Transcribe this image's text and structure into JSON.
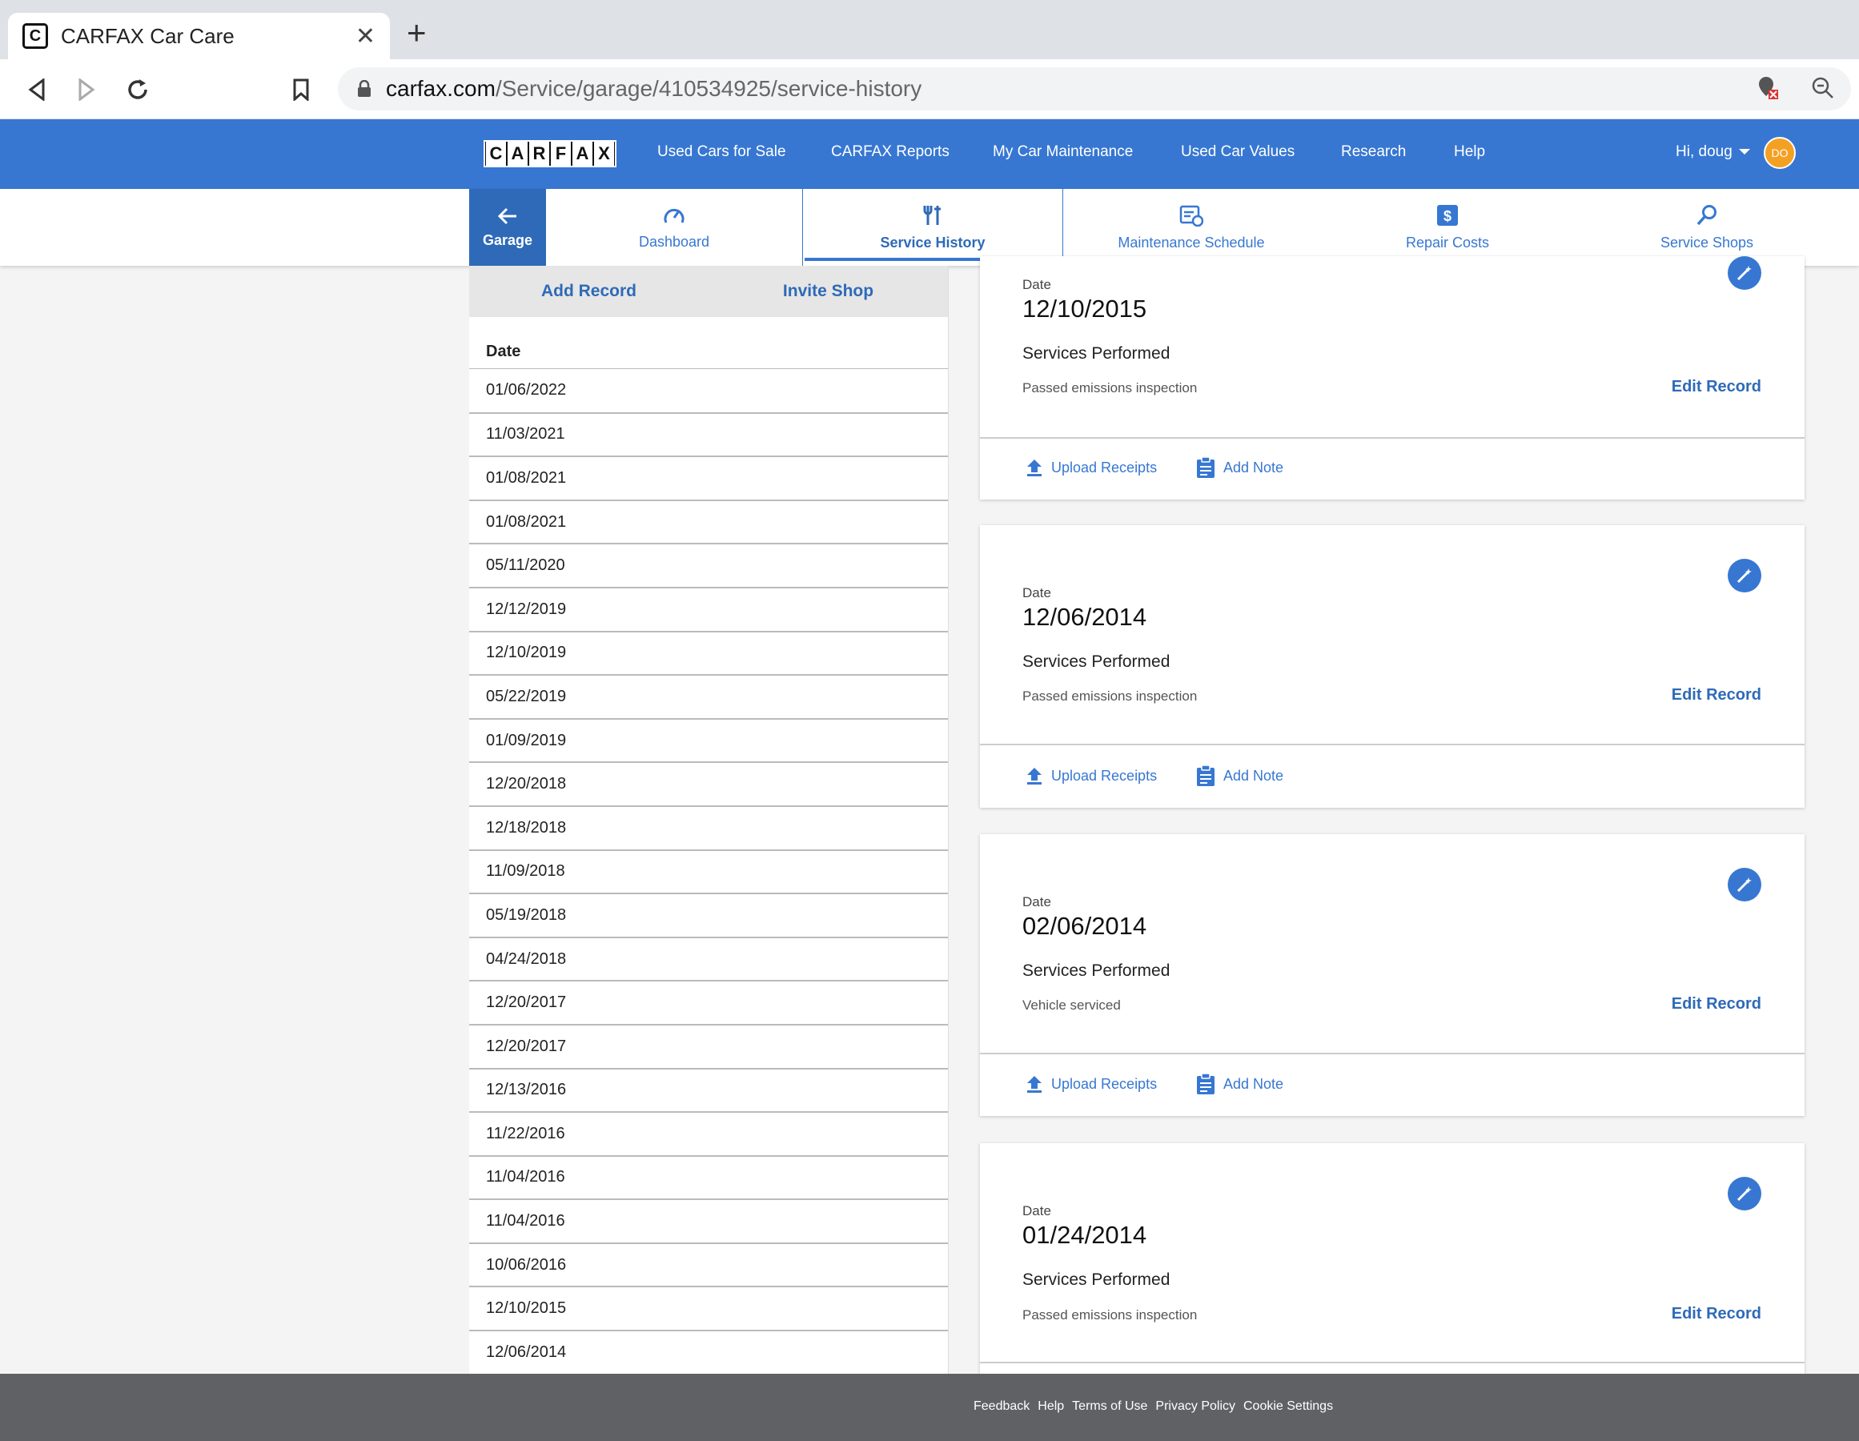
{
  "browser": {
    "tab_title": "CARFAX Car Care",
    "url_host": "carfax.com",
    "url_path": "/Service/garage/410534925/service-history"
  },
  "header": {
    "logo": "CARFAX",
    "nav": [
      "Used Cars for Sale",
      "CARFAX Reports",
      "My Car Maintenance",
      "Used Car Values",
      "Research",
      "Help"
    ],
    "user": "Hi, doug",
    "avatar": "DO"
  },
  "subnav": {
    "garage": "Garage",
    "tabs": [
      "Dashboard",
      "Service History",
      "Maintenance Schedule",
      "Repair Costs",
      "Service Shops"
    ],
    "active": "Service History"
  },
  "left_panel": {
    "add_record": "Add Record",
    "invite_shop": "Invite Shop",
    "date_header": "Date",
    "dates": [
      "01/06/2022",
      "11/03/2021",
      "01/08/2021",
      "01/08/2021",
      "05/11/2020",
      "12/12/2019",
      "12/10/2019",
      "05/22/2019",
      "01/09/2019",
      "12/20/2018",
      "12/18/2018",
      "11/09/2018",
      "05/19/2018",
      "04/24/2018",
      "12/20/2017",
      "12/20/2017",
      "12/13/2016",
      "11/22/2016",
      "11/04/2016",
      "11/04/2016",
      "10/06/2016",
      "12/10/2015",
      "12/06/2014"
    ]
  },
  "cards": [
    {
      "date_label": "Date",
      "date": "12/10/2015",
      "services_title": "Services Performed",
      "service": "Passed emissions inspection",
      "edit": "Edit Record",
      "upload": "Upload Receipts",
      "note": "Add Note"
    },
    {
      "date_label": "Date",
      "date": "12/06/2014",
      "services_title": "Services Performed",
      "service": "Passed emissions inspection",
      "edit": "Edit Record",
      "upload": "Upload Receipts",
      "note": "Add Note"
    },
    {
      "date_label": "Date",
      "date": "02/06/2014",
      "services_title": "Services Performed",
      "service": "Vehicle serviced",
      "edit": "Edit Record",
      "upload": "Upload Receipts",
      "note": "Add Note"
    },
    {
      "date_label": "Date",
      "date": "01/24/2014",
      "services_title": "Services Performed",
      "service": "Passed emissions inspection",
      "edit": "Edit Record",
      "upload": "Upload Receipts",
      "note": "Add Note"
    }
  ],
  "footer": {
    "links": [
      "Feedback",
      "Help",
      "Terms of Use",
      "Privacy Policy",
      "Cookie Settings"
    ]
  },
  "colors": {
    "brand_blue": "#3777d2",
    "dark_blue": "#2e6ab7",
    "avatar": "#f4a023",
    "footer": "#5f6165"
  }
}
